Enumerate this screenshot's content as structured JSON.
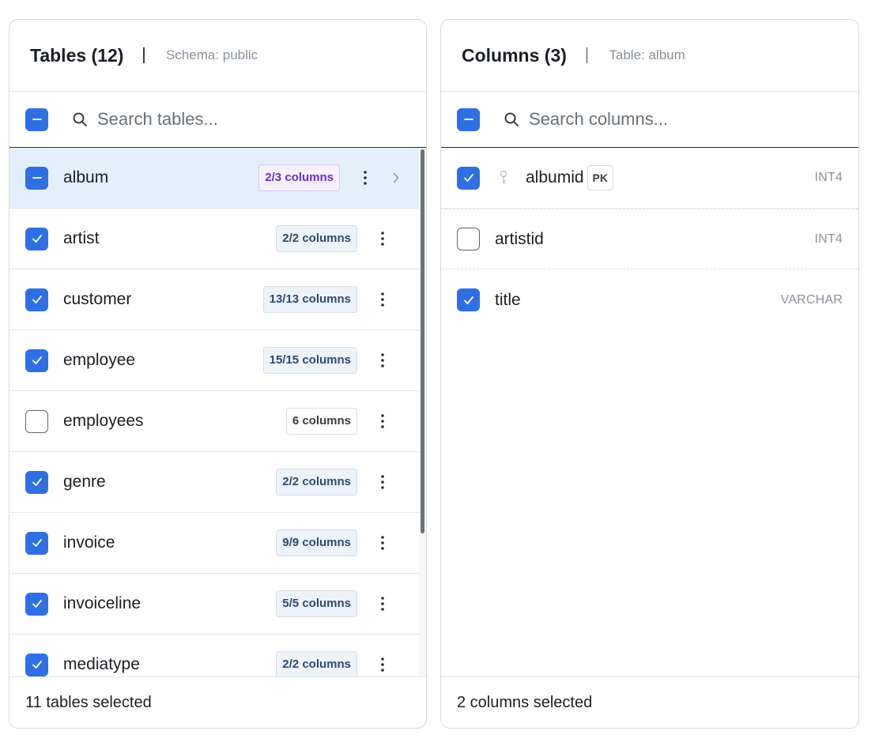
{
  "tables_panel": {
    "title": "Tables (12)",
    "subtitle": "Schema: public",
    "select_all_state": "partial",
    "search_placeholder": "Search tables...",
    "rows": [
      {
        "name": "album",
        "badge": "2/3 columns",
        "badge_style": "partial",
        "state": "partial",
        "active": true
      },
      {
        "name": "artist",
        "badge": "2/2 columns",
        "badge_style": "full",
        "state": "checked"
      },
      {
        "name": "customer",
        "badge": "13/13 columns",
        "badge_style": "full",
        "state": "checked"
      },
      {
        "name": "employee",
        "badge": "15/15 columns",
        "badge_style": "full",
        "state": "checked"
      },
      {
        "name": "employees",
        "badge": "6 columns",
        "badge_style": "none",
        "state": "empty"
      },
      {
        "name": "genre",
        "badge": "2/2 columns",
        "badge_style": "full",
        "state": "checked"
      },
      {
        "name": "invoice",
        "badge": "9/9 columns",
        "badge_style": "full",
        "state": "checked"
      },
      {
        "name": "invoiceline",
        "badge": "5/5 columns",
        "badge_style": "full",
        "state": "checked"
      },
      {
        "name": "mediatype",
        "badge": "2/2 columns",
        "badge_style": "full",
        "state": "checked"
      }
    ],
    "footer": "11 tables selected"
  },
  "columns_panel": {
    "title": "Columns (3)",
    "subtitle": "Table: album",
    "select_all_state": "partial",
    "search_placeholder": "Search columns...",
    "rows": [
      {
        "name": "albumid",
        "type": "INT4",
        "state": "checked",
        "primary_key": true,
        "pk_label": "PK",
        "icon": "key-icon"
      },
      {
        "name": "artistid",
        "type": "INT4",
        "state": "empty"
      },
      {
        "name": "title",
        "type": "VARCHAR",
        "state": "checked"
      }
    ],
    "footer": "2 columns selected"
  },
  "colors": {
    "accent": "#2f6fe4",
    "active_row": "#e3f0fc",
    "partial_badge_text": "#6a2fc6",
    "full_badge_text": "#2b4c73"
  }
}
